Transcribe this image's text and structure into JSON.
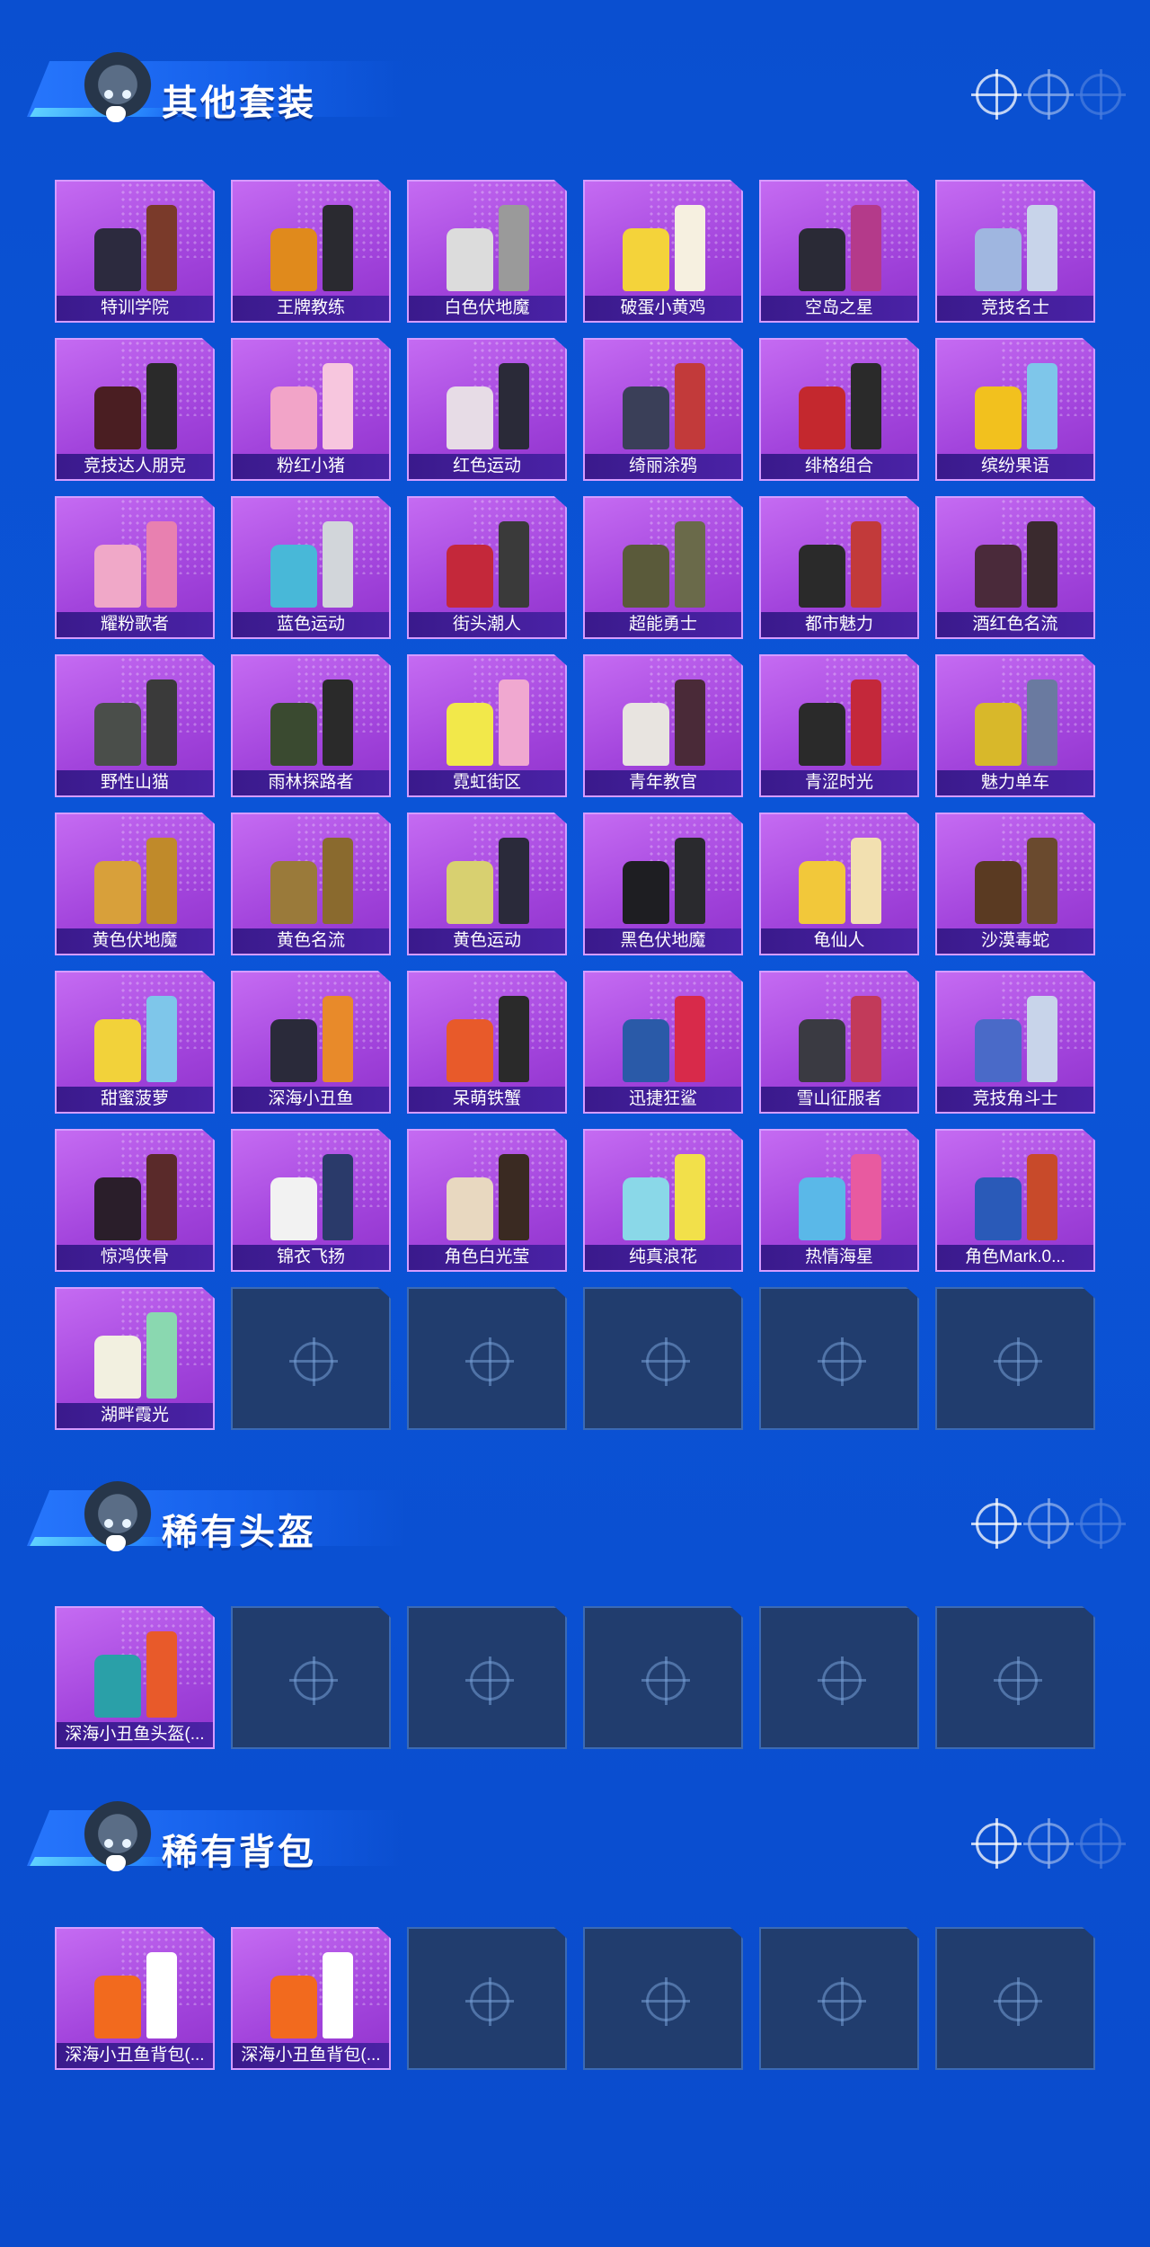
{
  "sections": [
    {
      "title": "其他套装",
      "items": [
        {
          "label": "特训学院",
          "colors": [
            "#2c2a3e",
            "#7a3a2a"
          ]
        },
        {
          "label": "王牌教练",
          "colors": [
            "#e08a1c",
            "#2a2a30"
          ]
        },
        {
          "label": "白色伏地魔",
          "colors": [
            "#dcdcdc",
            "#9a9a9a"
          ]
        },
        {
          "label": "破蛋小黄鸡",
          "colors": [
            "#f4d33a",
            "#f6f0e0"
          ]
        },
        {
          "label": "空岛之星",
          "colors": [
            "#2a2a36",
            "#b43a8a"
          ]
        },
        {
          "label": "竞技名士",
          "colors": [
            "#9fb6e0",
            "#c8d4ea"
          ]
        },
        {
          "label": "竞技达人朋克",
          "colors": [
            "#4a1e22",
            "#2a2a2a"
          ]
        },
        {
          "label": "粉红小猪",
          "colors": [
            "#f2a4c8",
            "#f7c6de"
          ]
        },
        {
          "label": "红色运动",
          "colors": [
            "#e7dce6",
            "#2a2a38"
          ]
        },
        {
          "label": "绮丽涂鸦",
          "colors": [
            "#3a3f58",
            "#c23a3a"
          ]
        },
        {
          "label": "绯格组合",
          "colors": [
            "#c4282e",
            "#2a2a2a"
          ]
        },
        {
          "label": "缤纷果语",
          "colors": [
            "#f2c11e",
            "#7ec6ea"
          ]
        },
        {
          "label": "耀粉歌者",
          "colors": [
            "#f0a8c8",
            "#e880b0"
          ]
        },
        {
          "label": "蓝色运动",
          "colors": [
            "#48b8d8",
            "#d2d6da"
          ]
        },
        {
          "label": "街头潮人",
          "colors": [
            "#c4283a",
            "#3a3a3a"
          ]
        },
        {
          "label": "超能勇士",
          "colors": [
            "#5a5a3a",
            "#6a6a4a"
          ]
        },
        {
          "label": "都市魅力",
          "colors": [
            "#2a2a2a",
            "#c23a3a"
          ]
        },
        {
          "label": "酒红色名流",
          "colors": [
            "#4a2a3a",
            "#3a2a2e"
          ]
        },
        {
          "label": "野性山猫",
          "colors": [
            "#4a4e4a",
            "#3a3a3a"
          ]
        },
        {
          "label": "雨林探路者",
          "colors": [
            "#3a4a30",
            "#2a2a2a"
          ]
        },
        {
          "label": "霓虹街区",
          "colors": [
            "#f2e84a",
            "#f0a8d0"
          ]
        },
        {
          "label": "青年教官",
          "colors": [
            "#e8e4e0",
            "#4a2a38"
          ]
        },
        {
          "label": "青涩时光",
          "colors": [
            "#2a2a2a",
            "#c4283a"
          ]
        },
        {
          "label": "魅力单车",
          "colors": [
            "#d8b82a",
            "#6a7aa0"
          ]
        },
        {
          "label": "黄色伏地魔",
          "colors": [
            "#d8a03a",
            "#c08a2a"
          ]
        },
        {
          "label": "黄色名流",
          "colors": [
            "#9a7a3a",
            "#8a6a2e"
          ]
        },
        {
          "label": "黄色运动",
          "colors": [
            "#d8d070",
            "#2a2a3a"
          ]
        },
        {
          "label": "黑色伏地魔",
          "colors": [
            "#1e1e22",
            "#2a2a2e"
          ]
        },
        {
          "label": "龟仙人",
          "colors": [
            "#f2c83a",
            "#f2e0b0"
          ]
        },
        {
          "label": "沙漠毒蛇",
          "colors": [
            "#5a3a22",
            "#6a4a2e"
          ]
        },
        {
          "label": "甜蜜菠萝",
          "colors": [
            "#f2d23a",
            "#7ec6ea"
          ]
        },
        {
          "label": "深海小丑鱼",
          "colors": [
            "#2a2a3a",
            "#e88a2a"
          ]
        },
        {
          "label": "呆萌铁蟹",
          "colors": [
            "#e85a2a",
            "#2a2a2a"
          ]
        },
        {
          "label": "迅捷狂鲨",
          "colors": [
            "#2a5aa8",
            "#d82a4a"
          ]
        },
        {
          "label": "雪山征服者",
          "colors": [
            "#3a3a42",
            "#c23a5a"
          ]
        },
        {
          "label": "竞技角斗士",
          "colors": [
            "#4a6ac8",
            "#c8d4ea"
          ]
        },
        {
          "label": "惊鸿侠骨",
          "colors": [
            "#2a1e2a",
            "#5a2a2a"
          ]
        },
        {
          "label": "锦衣飞扬",
          "colors": [
            "#f2f2f2",
            "#2a3a6a"
          ]
        },
        {
          "label": "角色白光莹",
          "colors": [
            "#e8d8c0",
            "#3a2a22"
          ]
        },
        {
          "label": "纯真浪花",
          "colors": [
            "#8ad8e8",
            "#f2e04a"
          ]
        },
        {
          "label": "热情海星",
          "colors": [
            "#5ab8e8",
            "#e85aa0"
          ]
        },
        {
          "label": "角色Mark.0...",
          "colors": [
            "#2a5ab8",
            "#c84a2a"
          ]
        },
        {
          "label": "湖畔霞光",
          "colors": [
            "#f2f0e0",
            "#8ad8b0"
          ]
        }
      ],
      "slots": 48
    },
    {
      "title": "稀有头盔",
      "items": [
        {
          "label": "深海小丑鱼头盔(...",
          "colors": [
            "#2aa0a8",
            "#e85a2a"
          ]
        }
      ],
      "slots": 6
    },
    {
      "title": "稀有背包",
      "items": [
        {
          "label": "深海小丑鱼背包(...",
          "colors": [
            "#f26a1e",
            "#ffffff"
          ]
        },
        {
          "label": "深海小丑鱼背包(...",
          "colors": [
            "#f26a1e",
            "#ffffff"
          ]
        }
      ],
      "slots": 6
    }
  ]
}
